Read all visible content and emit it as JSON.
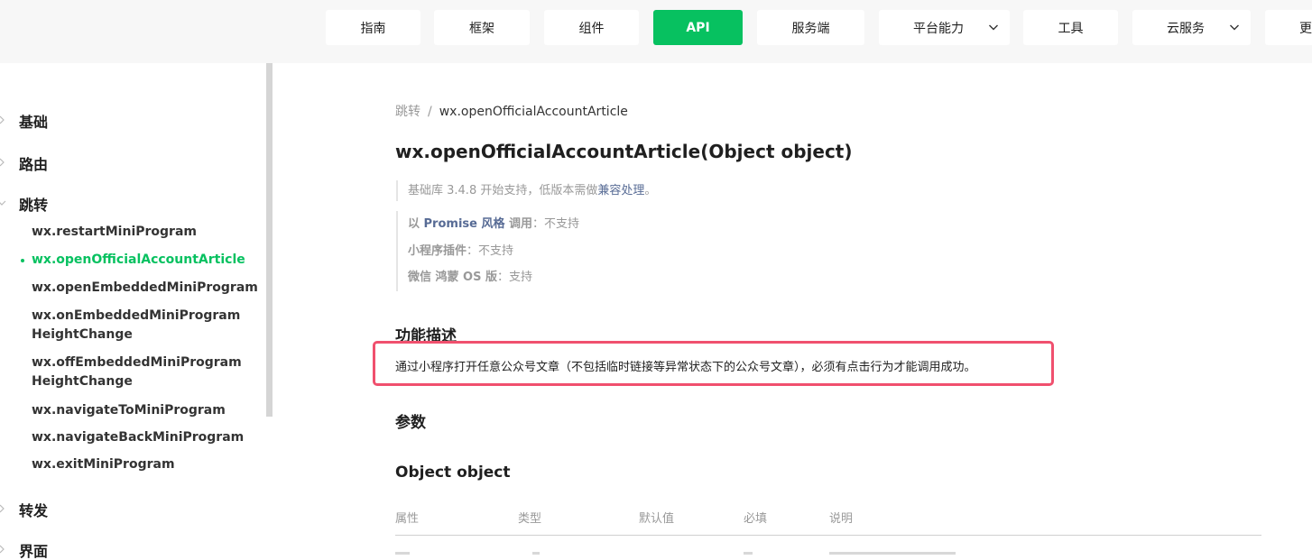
{
  "nav": {
    "items": [
      {
        "label": "指南"
      },
      {
        "label": "框架"
      },
      {
        "label": "组件"
      },
      {
        "label": "API",
        "active": true
      },
      {
        "label": "服务端"
      },
      {
        "label": "平台能力",
        "dropdown": true
      },
      {
        "label": "工具"
      },
      {
        "label": "云服务",
        "dropdown": true
      },
      {
        "label": "更"
      }
    ]
  },
  "sidebar": {
    "sections": [
      {
        "label": "基础"
      },
      {
        "label": "路由"
      },
      {
        "label": "跳转"
      },
      {
        "label": "转发"
      },
      {
        "label": "界面"
      }
    ],
    "items": [
      {
        "label": "wx.restartMiniProgram"
      },
      {
        "label": "wx.openOfficialAccountArticle",
        "current": true
      },
      {
        "label": "wx.openEmbeddedMiniProgram"
      },
      {
        "label": "wx.onEmbeddedMiniProgramHeightChange"
      },
      {
        "label": "wx.offEmbeddedMiniProgramHeightChange"
      },
      {
        "label": "wx.navigateToMiniProgram"
      },
      {
        "label": "wx.navigateBackMiniProgram"
      },
      {
        "label": "wx.exitMiniProgram"
      }
    ]
  },
  "main": {
    "breadcrumb": {
      "parent": "跳转",
      "separator": "/",
      "current": "wx.openOfficialAccountArticle"
    },
    "title": "wx.openOfficialAccountArticle(Object object)",
    "support": {
      "prefix": "基础库 3.4.8 开始支持，低版本需做",
      "link": "兼容处理",
      "suffix": "。"
    },
    "compat": {
      "promise_prefix": "以 ",
      "promise_link": "Promise 风格",
      "promise_mid": " 调用",
      "promise_value": "：不支持",
      "plugin_label": "小程序插件",
      "plugin_value": "：不支持",
      "harmony_label": "微信 鸿蒙 OS 版",
      "harmony_value": "：支持"
    },
    "feature_heading": "功能描述",
    "feature_text": "通过小程序打开任意公众号文章（不包括临时链接等异常状态下的公众号文章），必须有点击行为才能调用成功。",
    "params_heading": "参数",
    "object_heading": "Object object",
    "table_headers": [
      "属性",
      "类型",
      "默认值",
      "必填",
      "说明"
    ]
  },
  "colors": {
    "accent": "#07c160",
    "link": "#576b95",
    "highlight_box": "#f0506e"
  },
  "icons": {
    "dropdown": "chevron-down-icon",
    "section": "chevron-right-icon"
  }
}
